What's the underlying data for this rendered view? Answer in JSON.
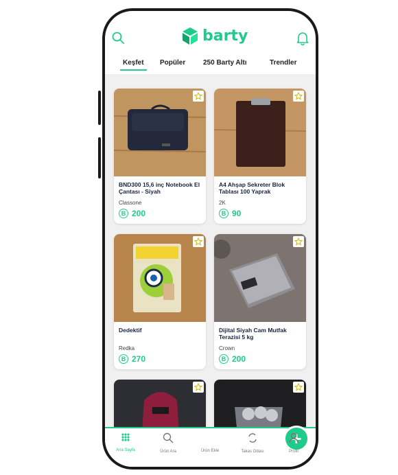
{
  "app": {
    "logo_text": "barty",
    "brand_color": "#1fcb8a"
  },
  "tabs": [
    {
      "label": "Keşfet",
      "active": true
    },
    {
      "label": "Popüler"
    },
    {
      "label": "250 Barty Altı"
    },
    {
      "label": "Trendler"
    }
  ],
  "currency_symbol": "B",
  "products": [
    {
      "title": "BND300 15,6 inç Notebook El Çantası - Siyah",
      "brand": "Classone",
      "price": "200"
    },
    {
      "title": "A4 Ahşap Sekreter Blok Tablası 100 Yaprak",
      "brand": "2K",
      "price": "90"
    },
    {
      "title": "Dedektif",
      "brand": "Redka",
      "price": "270"
    },
    {
      "title": "Dijital Siyah Cam Mutfak Terazisi 5 kg",
      "brand": "Crown",
      "price": "200"
    }
  ],
  "nav": [
    {
      "label": "Ana Sayfa",
      "icon": "grid-icon",
      "active": true
    },
    {
      "label": "Ürün Ara",
      "icon": "search-icon"
    },
    {
      "label": "Ürün Ekle",
      "icon": "plus-icon"
    },
    {
      "label": "Takas Odası",
      "icon": "swap-icon"
    },
    {
      "label": "Profil",
      "icon": "user-icon"
    }
  ]
}
